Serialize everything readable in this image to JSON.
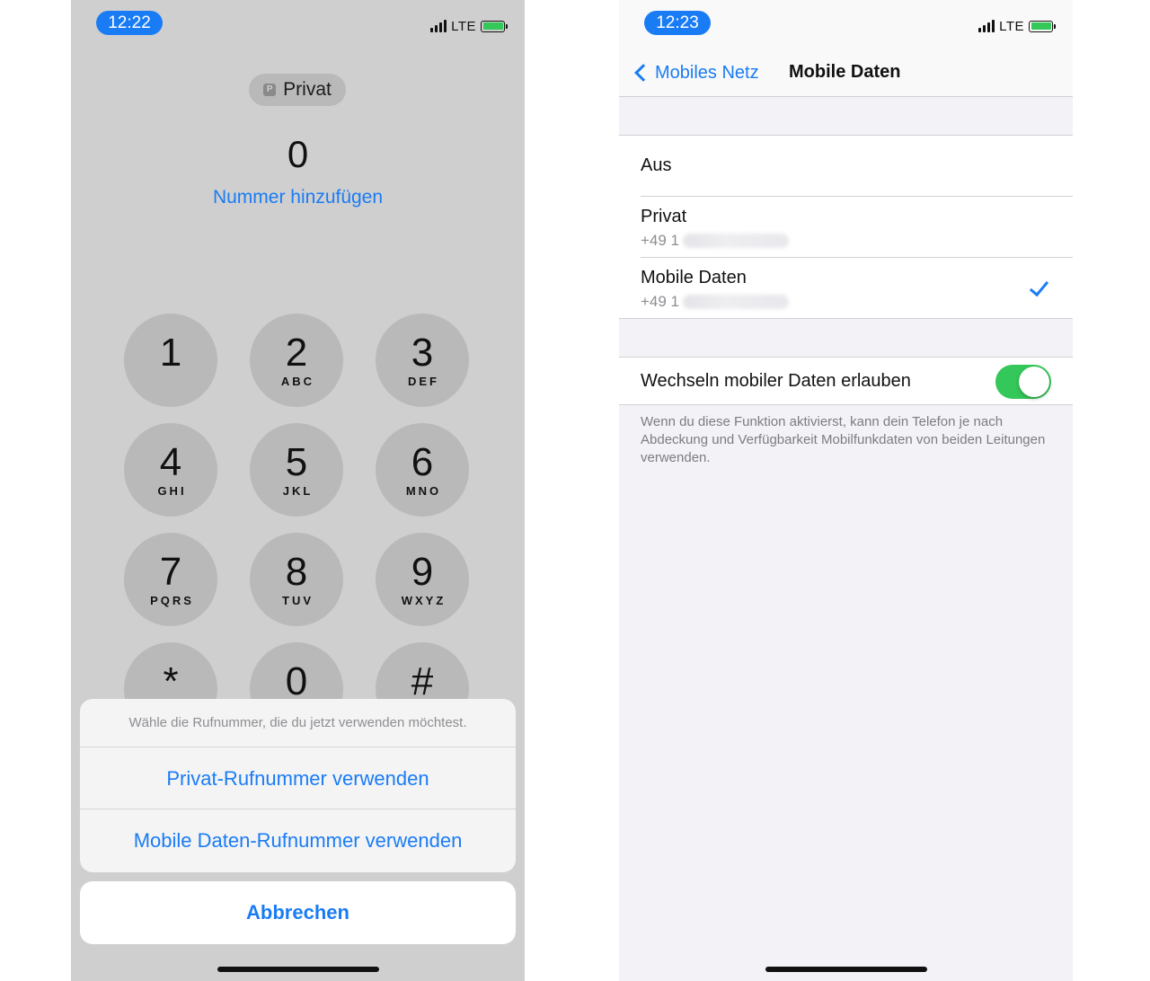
{
  "left_phone": {
    "status": {
      "time": "12:22",
      "network": "LTE"
    },
    "line_chip": {
      "icon_letter": "P",
      "label": "Privat"
    },
    "dial_number": "0",
    "add_number_link": "Nummer hinzufügen",
    "keypad": [
      {
        "digit": "1",
        "letters": ""
      },
      {
        "digit": "2",
        "letters": "ABC"
      },
      {
        "digit": "3",
        "letters": "DEF"
      },
      {
        "digit": "4",
        "letters": "GHI"
      },
      {
        "digit": "5",
        "letters": "JKL"
      },
      {
        "digit": "6",
        "letters": "MNO"
      },
      {
        "digit": "7",
        "letters": "PQRS"
      },
      {
        "digit": "8",
        "letters": "TUV"
      },
      {
        "digit": "9",
        "letters": "WXYZ"
      },
      {
        "digit": "*",
        "letters": ""
      },
      {
        "digit": "0",
        "letters": ""
      },
      {
        "digit": "#",
        "letters": ""
      }
    ],
    "action_sheet": {
      "title": "Wähle die Rufnummer, die du jetzt verwenden möchtest.",
      "options": [
        "Privat-Rufnummer verwenden",
        "Mobile Daten-Rufnummer verwenden"
      ],
      "cancel": "Abbrechen"
    }
  },
  "right_phone": {
    "status": {
      "time": "12:23",
      "network": "LTE"
    },
    "nav": {
      "back_label": "Mobiles Netz",
      "title": "Mobile Daten"
    },
    "sim_options": [
      {
        "label": "Aus",
        "number": "",
        "selected": false
      },
      {
        "label": "Privat",
        "number": "+49 1",
        "selected": false
      },
      {
        "label": "Mobile Daten",
        "number": "+49 1",
        "selected": true
      }
    ],
    "switch": {
      "label": "Wechseln mobiler Daten erlauben",
      "enabled": true
    },
    "footer_note": "Wenn du diese Funktion aktivierst, kann dein Telefon je nach Abdeckung und Verfügbarkeit Mobilfunkdaten von beiden Leitungen verwenden."
  },
  "colors": {
    "accent": "#1a7cf5",
    "toggle_on": "#34c759",
    "dialer_bg": "#cfcfcf",
    "settings_bg": "#f2f2f7"
  },
  "icons": [
    "signal-icon",
    "battery-icon",
    "sim-p-icon",
    "back-chevron-icon",
    "checkmark-icon"
  ]
}
